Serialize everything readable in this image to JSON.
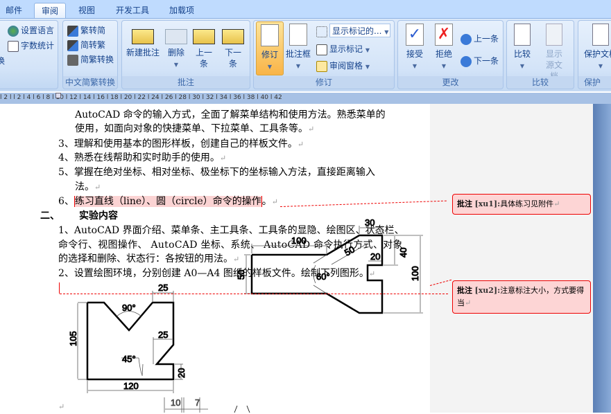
{
  "tabs": [
    {
      "label": "邮件"
    },
    {
      "label": "审阅",
      "active": true
    },
    {
      "label": "视图"
    },
    {
      "label": "开发工具"
    },
    {
      "label": "加载项"
    }
  ],
  "ribbon": {
    "proofing": {
      "set_language": "设置语言",
      "word_count": "字数统计",
      "partial": "换"
    },
    "chinese": {
      "label": "中文简繁转换",
      "to_simplified": "繁转简",
      "to_traditional": "简转繁",
      "convert": "简繁转换"
    },
    "comments": {
      "label": "批注",
      "new": "新建批注",
      "delete": "删除",
      "prev": "上一条",
      "next": "下一条"
    },
    "tracking": {
      "label": "修订",
      "track": "修订",
      "balloons": "批注框",
      "display_select": "显示标记的...",
      "show_markup": "显示标记",
      "reviewing_pane": "审阅窗格"
    },
    "changes": {
      "label": "更改",
      "accept": "接受",
      "reject": "拒绝",
      "prev": "上一条",
      "next": "下一条"
    },
    "compare": {
      "label": "比较",
      "compare": "比较",
      "show_source": "显示源文档"
    },
    "protect": {
      "label": "保护",
      "protect_doc": "保护文档"
    }
  },
  "ruler": {
    "ticks": "l 2 l   l 2 l  4 l  6 l  8 l 10 l 12 l 14 l 16 l 18 l 20 l 22 l 24 l 26 l 28 l 30 l 32 l 34 l 36 l 38 l 40 l 42"
  },
  "doc": {
    "lines": [
      "AutoCAD 命令的输入方式，全面了解菜单结构和使用方法。熟悉菜单的",
      "使用，如面向对象的快捷菜单、下拉菜单、工具条等。",
      "3、理解和使用基本的图形样板，创建自己的样板文件。",
      "4、熟悉在线帮助和实时助手的使用。",
      "5、掌握在绝对坐标、相对坐标、极坐标下的坐标输入方法，直接距离输入",
      "法。"
    ],
    "item6_num": "6、",
    "item6_text": "练习直线（line）、圆（circle）命令的操作",
    "item6_end": "。",
    "section_num": "二、",
    "section_title": "实验内容",
    "content": [
      "1、AutoCAD 界面介绍、菜单条、主工具条、工具条的显隐、绘图区、状态栏、",
      "命令行、视图操作、 AutoCAD 坐标、系统、 AutoCAD 命令执行方式、对象",
      "的选择和删除、状态行：各按钮的用法。",
      "2、设置绘图环境，分别创建 A0—A4 图纸的样板文件。绘制下列图形。"
    ],
    "paragraph_mark": "↵"
  },
  "drawing1": {
    "d_top": "25",
    "d_angle": "90°",
    "d_mid": "25",
    "d_angle2": "45°",
    "d_height": "105",
    "d_bottom": "20",
    "d_width": "120"
  },
  "drawing2": {
    "d_top": "30",
    "d_len": "100",
    "d_slant": "50",
    "d_notch": "20",
    "d_right1": "40",
    "d_height": "100",
    "d_left": "50",
    "d_angle": "60°"
  },
  "drawing3": {
    "d1": "10",
    "d2": "7"
  },
  "comments": [
    {
      "label": "批注",
      "author": "[xu1]:",
      "text": "具体练习见附件"
    },
    {
      "label": "批注",
      "author": "[xu2]:",
      "text": "注意标注大小，方式要得当"
    }
  ]
}
